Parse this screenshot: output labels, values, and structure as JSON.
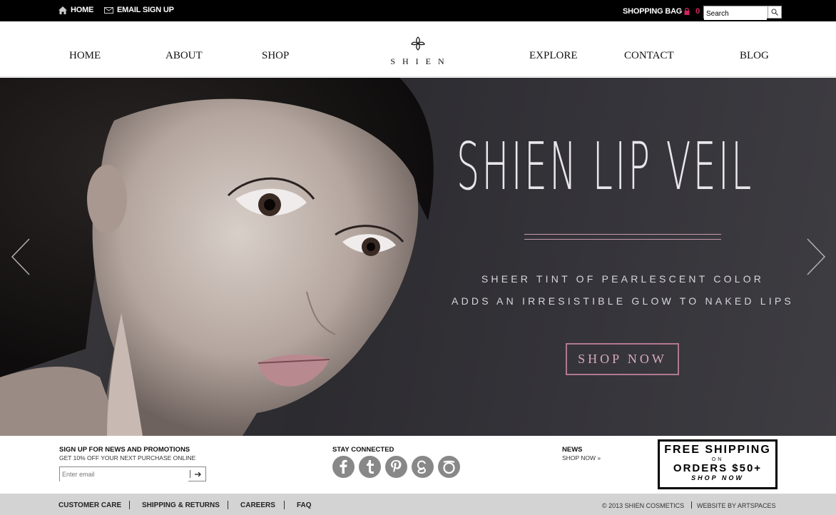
{
  "topbar": {
    "home_label": "HOME",
    "email_signup_label": "EMAIL SIGN UP",
    "shopping_bag_label": "SHOPPING BAG",
    "bag_count": "0",
    "search_placeholder": "Search"
  },
  "nav": {
    "items": [
      "HOME",
      "ABOUT",
      "SHOP",
      "EXPLORE",
      "CONTACT",
      "BLOG"
    ],
    "logo_text": "SHIEN"
  },
  "hero": {
    "title": "SHIEN LIP VEIL",
    "subtitle_line1": "SHEER TINT OF PEARLESCENT COLOR",
    "subtitle_line2": "ADDS AN IRRESISTIBLE GLOW TO NAKED LIPS",
    "cta_label": "SHOP NOW",
    "accent_color": "#b0798f"
  },
  "footer": {
    "signup_heading": "SIGN UP FOR NEWS AND PROMOTIONS",
    "signup_sub": "GET 10% OFF YOUR NEXT PURCHASE ONLINE",
    "email_placeholder": "Enter email",
    "stay_connected": "STAY CONNECTED",
    "social_icons": [
      "facebook-icon",
      "tumblr-icon",
      "pinterest-icon",
      "google-plus-icon",
      "ring-icon"
    ],
    "news_heading": "NEWS",
    "news_link": "SHOP NOW »",
    "promo_line1": "FREE SHIPPING",
    "promo_line2": "ON",
    "promo_line3": "ORDERS $50+",
    "promo_line4": "SHOP NOW"
  },
  "bottombar": {
    "links": [
      "CUSTOMER CARE",
      "SHIPPING & RETURNS",
      "CAREERS",
      "FAQ"
    ],
    "copyright": "© 2013 SHIEN COSMETICS",
    "credit": "WEBSITE BY ARTSPACES"
  }
}
